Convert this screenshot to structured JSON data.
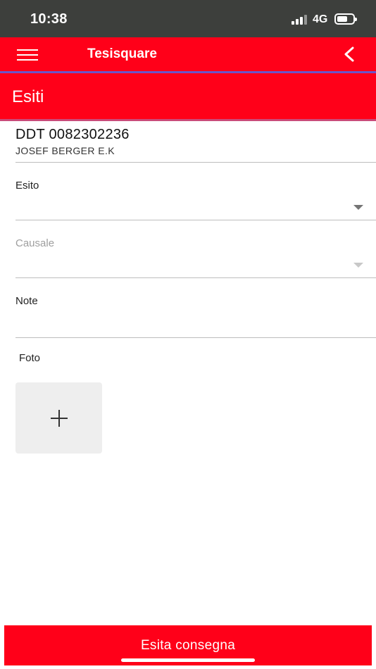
{
  "status_bar": {
    "time": "10:38",
    "network": "4G",
    "signal_icon": "cellular-signal-icon",
    "battery_icon": "battery-icon"
  },
  "app_bar": {
    "title": "Tesisquare",
    "menu_icon": "hamburger-menu-icon",
    "back_icon": "chevron-left-icon"
  },
  "page": {
    "title": "Esiti"
  },
  "document": {
    "number": "DDT 0082302236",
    "customer": "JOSEF BERGER E.K"
  },
  "form": {
    "esito": {
      "label": "Esito",
      "value": ""
    },
    "causale": {
      "label": "Causale",
      "value": ""
    },
    "note": {
      "label": "Note",
      "value": ""
    },
    "foto": {
      "label": "Foto",
      "add_icon": "plus-icon"
    }
  },
  "actions": {
    "submit_label": "Esita consegna"
  },
  "colors": {
    "primary": "#ff0019",
    "status_bar": "#3d3f3c"
  }
}
